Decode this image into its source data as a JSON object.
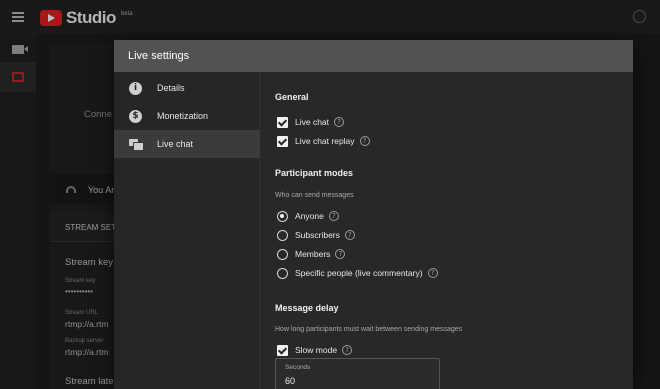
{
  "app": {
    "title": "Studio",
    "beta_label": "beta"
  },
  "rail": {
    "items": [
      {
        "icon": "video-camera-icon"
      },
      {
        "icon": "live-stream-icon",
        "accent": "#c62828"
      }
    ]
  },
  "background": {
    "connect_text": "Conne",
    "status_text": "You Ar",
    "tab_label": "STREAM SET",
    "stream_key_heading": "Stream key",
    "stream_key_label": "Stream key",
    "stream_key_value": "••••••••••",
    "stream_url_label": "Stream URL",
    "stream_url_value": "rtmp://a.rtm",
    "backup_label": "Backup server",
    "backup_value": "rtmp://a.rtm",
    "latency_heading": "Stream late"
  },
  "modal": {
    "title": "Live settings",
    "nav": [
      {
        "label": "Details",
        "icon": "info-icon",
        "glyph": "i"
      },
      {
        "label": "Monetization",
        "icon": "dollar-icon",
        "glyph": "$"
      },
      {
        "label": "Live chat",
        "icon": "chat-icon",
        "active": true
      }
    ],
    "general": {
      "title": "General",
      "options": [
        {
          "label": "Live chat",
          "checked": true
        },
        {
          "label": "Live chat replay",
          "checked": true
        }
      ]
    },
    "participant_modes": {
      "title": "Participant modes",
      "subtitle": "Who can send messages",
      "options": [
        {
          "label": "Anyone",
          "selected": true
        },
        {
          "label": "Subscribers",
          "selected": false
        },
        {
          "label": "Members",
          "selected": false
        },
        {
          "label": "Specific people (live commentary)",
          "selected": false
        }
      ]
    },
    "message_delay": {
      "title": "Message delay",
      "subtitle": "How long participants must wait between sending messages",
      "slow_mode_label": "Slow mode",
      "slow_mode_checked": true,
      "seconds_label": "Seconds",
      "seconds_value": "60"
    },
    "help_glyph": "?"
  },
  "colors": {
    "brand": "#e02020",
    "header": "#525252",
    "active_nav": "#3b3b3b"
  }
}
